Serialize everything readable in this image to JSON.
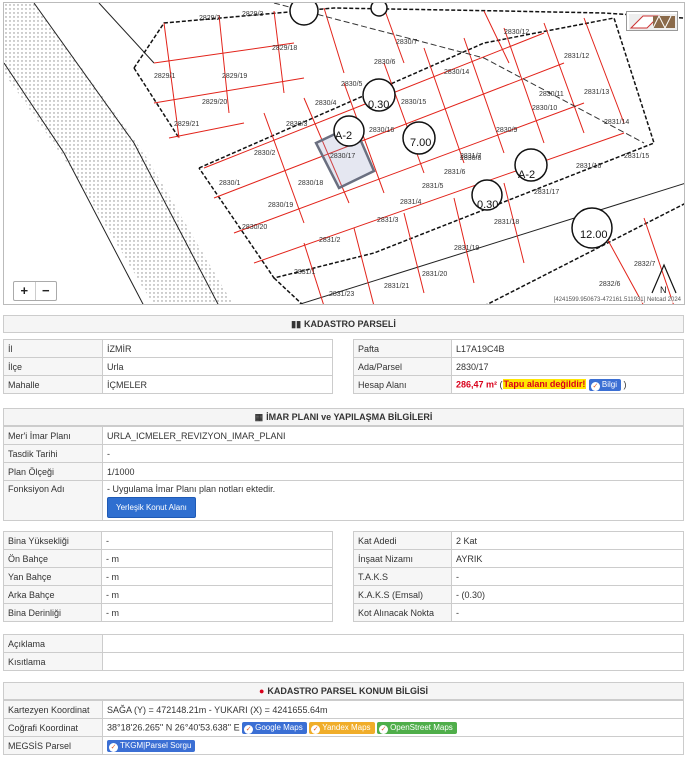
{
  "map": {
    "zoom_in": "+",
    "zoom_out": "−",
    "attribution": "[4241599.950673-472161.511931] Netcad 2024",
    "parcel_labels": [
      "2829/2",
      "2829/3",
      "2829/18",
      "2829/1",
      "2829/19",
      "2829/20",
      "2829/21",
      "2830/7",
      "2830/6",
      "2830/5",
      "2830/4",
      "2830/3",
      "2830/2",
      "2830/1",
      "2830/17",
      "2830/18",
      "2830/19",
      "2830/20",
      "2830/16",
      "2830/15",
      "2830/14",
      "2830/12",
      "2830/10",
      "2830/9",
      "2830/8",
      "2830/11",
      "2831/12",
      "2831/13",
      "2831/14",
      "2831/15",
      "2831/16",
      "2831/17",
      "2831/18",
      "2831/19",
      "2831/20",
      "2831/21",
      "2831/1",
      "2831/2",
      "2831/3",
      "2831/4",
      "2831/5",
      "2831/6",
      "2831/7",
      "2831/23",
      "2832/6",
      "2832/7"
    ],
    "zone_labels": [
      "0.30",
      "0.30",
      "A-2",
      "A-2",
      "12.00",
      "7.00"
    ],
    "north": "N"
  },
  "kadastro": {
    "title": "KADASTRO PARSELİ",
    "il_label": "İl",
    "il": "İZMİR",
    "ilce_label": "İlçe",
    "ilce": "Urla",
    "mahalle_label": "Mahalle",
    "mahalle": "İÇMELER",
    "pafta_label": "Pafta",
    "pafta": "L17A19C4B",
    "ada_label": "Ada/Parsel",
    "ada": "2830/17",
    "alan_label": "Hesap Alanı",
    "alan": "286,47 m²",
    "alan_note_open": "(",
    "alan_warning": "Tapu alanı değildir!",
    "alan_note_close": ")",
    "bilgi": "Bilgi"
  },
  "imar": {
    "title": "İMAR PLANI ve YAPILAŞMA BİLGİLERİ",
    "mer_label": "Mer'i İmar Planı",
    "mer": "URLA_ICMELER_REVIZYON_IMAR_PLANI",
    "tasdik_label": "Tasdik Tarihi",
    "tasdik": "-",
    "olcek_label": "Plan Ölçeği",
    "olcek": "1/1000",
    "fonksiyon_label": "Fonksiyon Adı",
    "fonksiyon": "- Uygulama İmar Planı plan notları ektedir.",
    "fonksiyon_button": "Yerleşik Konut Alanı"
  },
  "yapi": {
    "rows_left": [
      {
        "label": "Bina Yüksekliği",
        "value": "-"
      },
      {
        "label": "Ön Bahçe",
        "value": "- m"
      },
      {
        "label": "Yan Bahçe",
        "value": "- m"
      },
      {
        "label": "Arka Bahçe",
        "value": "- m"
      },
      {
        "label": "Bina Derinliği",
        "value": "- m"
      }
    ],
    "rows_right": [
      {
        "label": "Kat Adedi",
        "value": "2 Kat"
      },
      {
        "label": "İnşaat Nizamı",
        "value": "AYRIK"
      },
      {
        "label": "T.A.K.S",
        "value": "-"
      },
      {
        "label": "K.A.K.S (Emsal)",
        "value": "- (0.30)"
      },
      {
        "label": "Kot Alınacak Nokta",
        "value": "-"
      }
    ]
  },
  "aciklama": {
    "aciklama_label": "Açıklama",
    "aciklama": "",
    "kisitlama_label": "Kısıtlama",
    "kisitlama": ""
  },
  "konum": {
    "title": "KADASTRO PARSEL KONUM BİLGİSİ",
    "kartezyen_label": "Kartezyen Koordinat",
    "kartezyen": "SAĞA (Y) = 472148.21m - YUKARI (X) = 4241655.64m",
    "cografi_label": "Coğrafi Koordinat",
    "cografi": "38°18'26.265'' N 26°40'53.638'' E",
    "google": "Google Maps",
    "yandex": "Yandex Maps",
    "osm": "OpenStreet Maps",
    "megsis_label": "MEGSİS Parsel",
    "tkgm": "TKGM|Parsel Sorgu"
  },
  "colors": {
    "parcel_line": "#e2231a",
    "accent_red": "#d9001b",
    "button_blue": "#2f6fd0"
  }
}
